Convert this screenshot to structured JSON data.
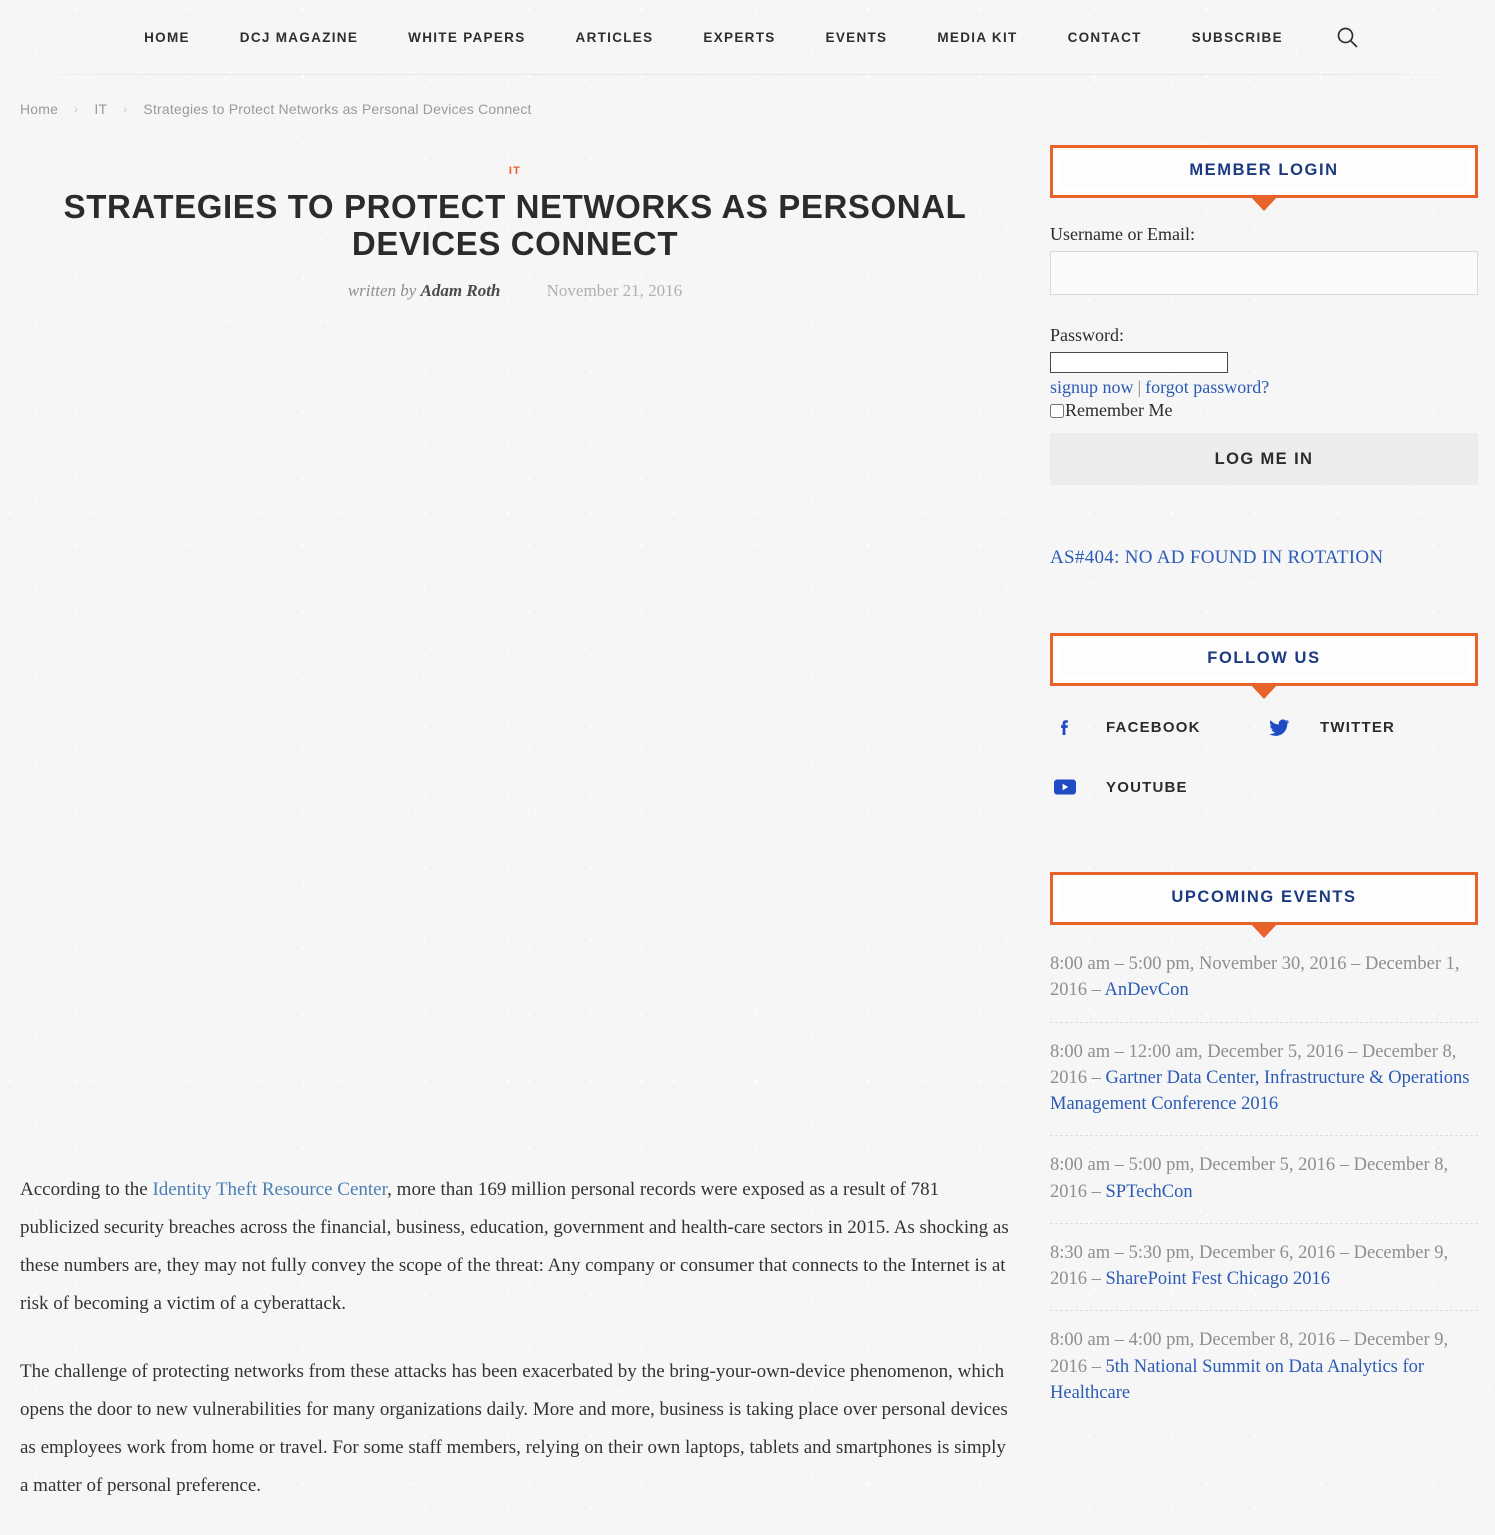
{
  "nav": {
    "items": [
      {
        "label": "HOME",
        "name": "nav-item-home"
      },
      {
        "label": "DCJ MAGAZINE",
        "name": "nav-item-dcj-magazine"
      },
      {
        "label": "WHITE PAPERS",
        "name": "nav-item-white-papers"
      },
      {
        "label": "ARTICLES",
        "name": "nav-item-articles"
      },
      {
        "label": "EXPERTS",
        "name": "nav-item-experts"
      },
      {
        "label": "EVENTS",
        "name": "nav-item-events"
      },
      {
        "label": "MEDIA KIT",
        "name": "nav-item-media-kit"
      },
      {
        "label": "CONTACT",
        "name": "nav-item-contact"
      },
      {
        "label": "SUBSCRIBE",
        "name": "nav-item-subscribe"
      }
    ],
    "search_icon": "search-icon"
  },
  "breadcrumb": {
    "home": "Home",
    "category": "IT",
    "current": "Strategies to Protect Networks as Personal Devices Connect",
    "separator": "›"
  },
  "article": {
    "category": "IT",
    "title": "STRATEGIES TO PROTECT NETWORKS AS PERSONAL DEVICES CONNECT",
    "written_by_label": "written by",
    "author": "Adam Roth",
    "date": "November 21, 2016",
    "paragraphs": [
      {
        "before_link": "According to the ",
        "link": "Identity Theft Resource Center",
        "after_link": ", more than 169 million personal records were exposed as a result of 781 publicized security breaches across the financial, business, education, government and health-care sectors in 2015. As shocking as these numbers are, they may not fully convey the scope of the threat: Any company or consumer that connects to the Internet is at risk of becoming a victim of a cyberattack."
      },
      {
        "text": "The challenge of protecting networks from these attacks has been exacerbated by the bring-your-own-device phenomenon, which opens the door to new vulnerabilities for many organizations daily. More and more, business is taking place over personal devices as employees work from home or travel. For some staff members, relying on their own laptops, tablets and smartphones is simply a matter of personal preference."
      }
    ]
  },
  "sidebar": {
    "login": {
      "heading": "MEMBER LOGIN",
      "username_label": "Username or Email:",
      "username_value": "",
      "password_label": "Password:",
      "password_value": "",
      "signup_link": "signup now",
      "pipe": "|",
      "forgot_link": "forgot password?",
      "remember_label": "Remember Me",
      "remember_checked": false,
      "submit_label": "LOG ME IN"
    },
    "ad": {
      "text": "AS#404: NO AD FOUND IN ROTATION"
    },
    "follow": {
      "heading": "FOLLOW US",
      "items": [
        {
          "label": "FACEBOOK",
          "icon": "facebook-icon"
        },
        {
          "label": "TWITTER",
          "icon": "twitter-icon"
        },
        {
          "label": "YOUTUBE",
          "icon": "youtube-icon"
        }
      ]
    },
    "events": {
      "heading": "UPCOMING EVENTS",
      "items": [
        {
          "when": "8:00 am – 5:00 pm, November 30, 2016 – December 1, 2016",
          "dash": " – ",
          "title": "AnDevCon"
        },
        {
          "when": "8:00 am – 12:00 am, December 5, 2016 – December 8, 2016",
          "dash": " – ",
          "title": "Gartner Data Center, Infrastructure & Operations Management Conference 2016"
        },
        {
          "when": "8:00 am – 5:00 pm, December 5, 2016 – December 8, 2016",
          "dash": " – ",
          "title": "SPTechCon"
        },
        {
          "when": "8:30 am – 5:30 pm, December 6, 2016 – December 9, 2016",
          "dash": " – ",
          "title": "SharePoint Fest Chicago 2016"
        },
        {
          "when": "8:00 am – 4:00 pm, December 8, 2016 – December 9, 2016",
          "dash": " – ",
          "title": "5th National Summit on Data Analytics for Healthcare"
        }
      ]
    }
  },
  "colors": {
    "accent_orange": "#e8622c",
    "heading_blue": "#1b3a80",
    "link_blue": "#2b5bb5",
    "body_text": "#333333",
    "page_bg": "#f6f6f6"
  }
}
